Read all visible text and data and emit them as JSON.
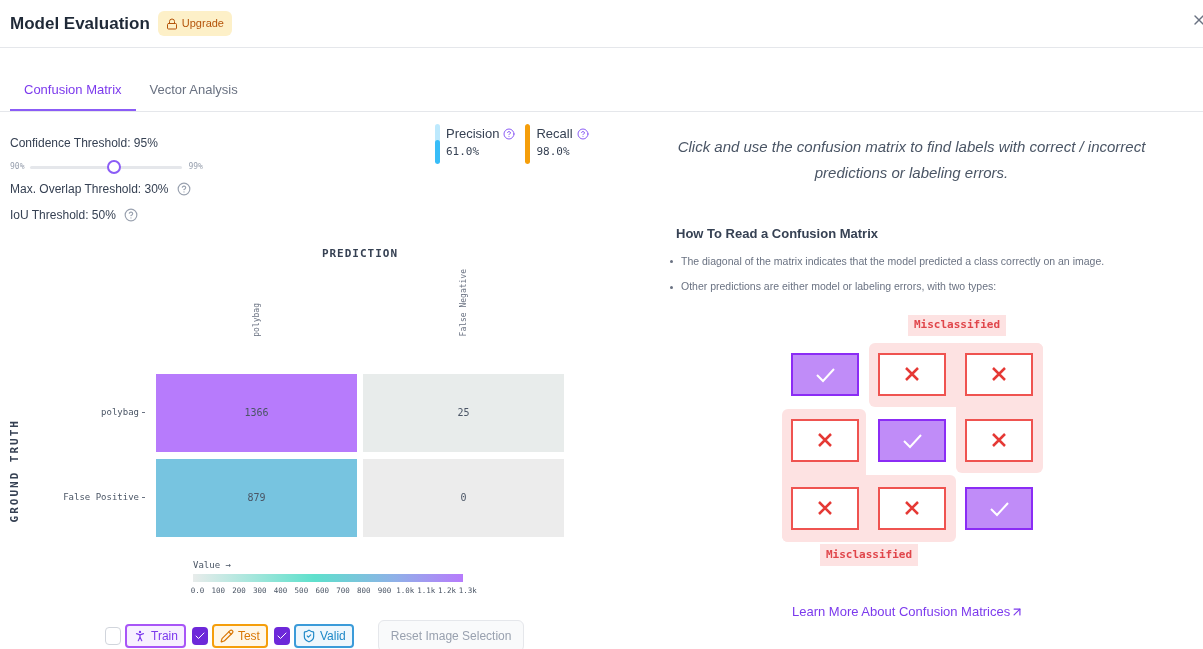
{
  "header": {
    "title": "Model Evaluation",
    "badge": "Upgrade"
  },
  "tabs": [
    {
      "label": "Confusion Matrix",
      "selected": true
    },
    {
      "label": "Vector Analysis",
      "selected": false
    }
  ],
  "controls": {
    "confidence": {
      "label": "Confidence Threshold: 95%",
      "min": "90%",
      "max": "99%",
      "level": 0.55
    },
    "overlap": "Max. Overlap Threshold: 30%",
    "iou": "IoU Threshold: 50%"
  },
  "metrics": [
    {
      "name": "Precision",
      "value": "61.0%",
      "level": 0.61,
      "color": "#38bdf8"
    },
    {
      "name": "Recall",
      "value": "98.0%",
      "level": 1,
      "color": "#f59e0b"
    }
  ],
  "matrix": {
    "x_title": "PREDICTION",
    "y_title": "GROUND TRUTH",
    "columns": [
      "polybag",
      "False Negative"
    ],
    "rows": [
      {
        "label": "polybag",
        "cells": [
          {
            "value": "1366",
            "color": "#b77bfc"
          },
          {
            "value": "25",
            "color": "#e8eceb"
          }
        ]
      },
      {
        "label": "False Positive",
        "cells": [
          {
            "value": "879",
            "color": "#77c4e0"
          },
          {
            "value": "0",
            "color": "#ececec"
          }
        ]
      }
    ],
    "legend": {
      "title": "Value →",
      "ticks": [
        "0.0",
        "100",
        "200",
        "300",
        "400",
        "500",
        "600",
        "700",
        "800",
        "900",
        "1.0k",
        "1.1k",
        "1.2k",
        "1.3k"
      ]
    }
  },
  "filters": [
    {
      "label": "Train",
      "checked": false,
      "kind": "train"
    },
    {
      "label": "Test",
      "checked": true,
      "kind": "test"
    },
    {
      "label": "Valid",
      "checked": true,
      "kind": "valid"
    }
  ],
  "reset_button": {
    "label": "Reset Image Selection",
    "disabled": true
  },
  "intro": "Click and use the confusion matrix to find labels with correct / incorrect predictions or labeling errors.",
  "guide": {
    "title": "How To Read a Confusion Matrix",
    "bullets": [
      "The diagonal of the matrix indicates that the model predicted a class correctly on an image.",
      "Other predictions are either model or labeling errors, with two types:"
    ]
  },
  "diagram": {
    "labels": [
      "Misclassified",
      "Misclassified"
    ],
    "cells": [
      {
        "kind": "correct"
      },
      {
        "kind": "error"
      },
      {
        "kind": "error"
      },
      {
        "kind": "error"
      },
      {
        "kind": "correct"
      },
      {
        "kind": "error"
      },
      {
        "kind": "error"
      },
      {
        "kind": "error"
      },
      {
        "kind": "correct"
      }
    ]
  },
  "link": "Learn More About Confusion Matrices"
}
